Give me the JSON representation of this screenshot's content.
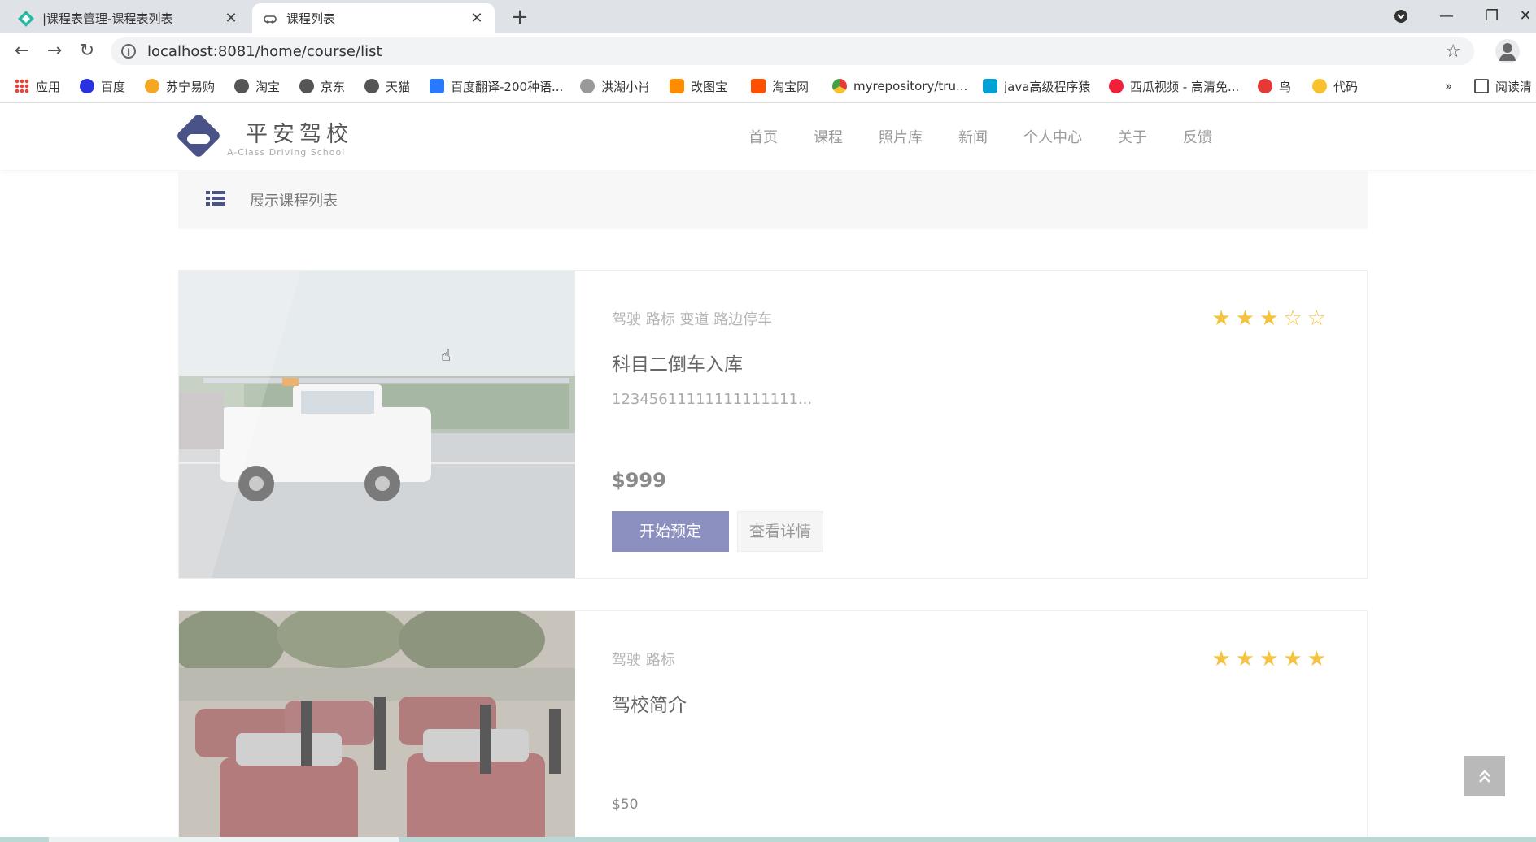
{
  "browser": {
    "tabs": [
      {
        "title": "|课程表管理-课程表列表",
        "active": false
      },
      {
        "title": "课程列表",
        "active": true
      }
    ],
    "url": "localhost:8081/home/course/list",
    "bookmarks": [
      {
        "label": "应用",
        "color": "#4285f4"
      },
      {
        "label": "百度",
        "color": "#2932e1"
      },
      {
        "label": "苏宁易购",
        "color": "#f5a623"
      },
      {
        "label": "淘宝",
        "color": "#555555"
      },
      {
        "label": "京东",
        "color": "#555555"
      },
      {
        "label": "天猫",
        "color": "#555555"
      },
      {
        "label": "百度翻译-200种语...",
        "color": "#2979ff"
      },
      {
        "label": "洪湖小肖",
        "color": "#777777"
      },
      {
        "label": "改图宝",
        "color": "#ff8c00"
      },
      {
        "label": "淘宝网",
        "color": "#ff5000"
      },
      {
        "label": "myrepository/tru...",
        "color": "#e53935"
      },
      {
        "label": "java高级程序猿",
        "color": "#00a1d6"
      },
      {
        "label": "西瓜视频 - 高清免...",
        "color": "#f0203b"
      },
      {
        "label": "鸟",
        "color": "#e53935"
      },
      {
        "label": "代码",
        "color": "#fbc02d"
      }
    ],
    "bookmarks_overflow": "»",
    "reading_list": "阅读清"
  },
  "site": {
    "logo_name": "平安驾校",
    "logo_sub": "A-Class Driving School",
    "nav": [
      "首页",
      "课程",
      "照片库",
      "新闻",
      "个人中心",
      "关于",
      "反馈"
    ],
    "panel_title": "展示课程列表"
  },
  "courses": [
    {
      "tags": "驾驶 路标 变道 路边停车",
      "rating": 3,
      "stars": "★★★☆☆",
      "title": "科目二倒车入库",
      "desc": "12345611111111111111...",
      "price": "$999",
      "book_label": "开始预定",
      "detail_label": "查看详情"
    },
    {
      "tags": "驾驶 路标",
      "rating": 5,
      "stars": "★★★★★",
      "title": "驾校简介",
      "desc": "",
      "price": "$50"
    }
  ],
  "colors": {
    "accent": "#4a5388",
    "star": "#f5c340",
    "book_button": "#8c90c0"
  }
}
